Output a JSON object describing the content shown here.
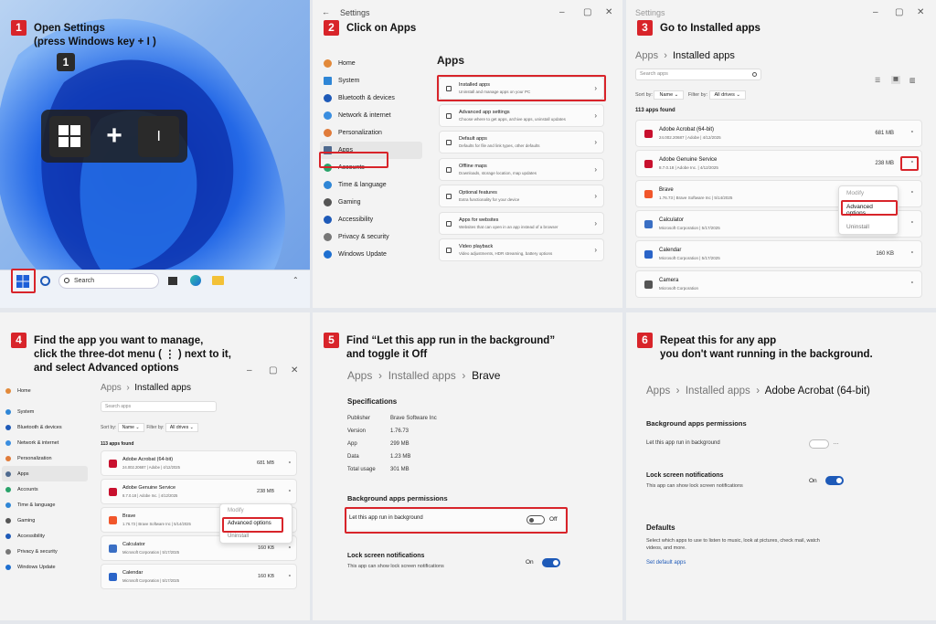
{
  "colors": {
    "accent": "#d8242a",
    "toggle_on": "#1e5ab8",
    "win_blue": "#1d5fd8"
  },
  "p1": {
    "num": "1",
    "title1": "Open Settings",
    "title2": "(press Windows key + I )",
    "badge": "1",
    "key_plus": "+",
    "key_i": "I",
    "search": "Search"
  },
  "p2": {
    "num": "2",
    "title": "Click on Apps",
    "win_title": "Settings",
    "header": "Apps",
    "nav": [
      "Home",
      "System",
      "Bluetooth & devices",
      "Network & internet",
      "Personalization",
      "Apps",
      "Accounts",
      "Time & language",
      "Gaming",
      "Accessibility",
      "Privacy & security",
      "Windows Update"
    ],
    "items": [
      {
        "t": "Installed apps",
        "d": "Uninstall and manage apps on your PC"
      },
      {
        "t": "Advanced app settings",
        "d": "Choose where to get apps, archive apps, uninstall updates"
      },
      {
        "t": "Default apps",
        "d": "Defaults for file and link types, other defaults"
      },
      {
        "t": "Offline maps",
        "d": "Downloads, storage location, map updates"
      },
      {
        "t": "Optional features",
        "d": "Extra functionality for your device"
      },
      {
        "t": "Apps for websites",
        "d": "Websites that can open in an app instead of a browser"
      },
      {
        "t": "Video playback",
        "d": "Video adjustments, HDR streaming, battery options"
      }
    ]
  },
  "p3": {
    "num": "3",
    "title": "Go to Installed apps",
    "win_title": "Settings",
    "crumb1": "Apps",
    "crumb2": "Installed apps",
    "search": "Search apps",
    "sortby": "Sort by:",
    "sortval": "Name",
    "filter": "Filter by:",
    "filterval": "All drives",
    "count": "113 apps found",
    "apps": [
      {
        "n": "Adobe Acrobat (64-bit)",
        "m": "24.002.20687  |  Adobe  |  4/12/2025",
        "s": "681 MB",
        "c": "#c8102e"
      },
      {
        "n": "Adobe Genuine Service",
        "m": "8.7.0.18  |  Adobe Inc.  |  4/12/2025",
        "s": "238 MB",
        "c": "#c8102e"
      },
      {
        "n": "Brave",
        "m": "1.76.73  |  Brave Software Inc  |  5/14/2025",
        "s": "",
        "c": "#f1562b"
      },
      {
        "n": "Calculator",
        "m": "Microsoft Corporation  |  5/17/2025",
        "s": "",
        "c": "#3a6fc4"
      },
      {
        "n": "Calendar",
        "m": "Microsoft Corporation  |  5/17/2025",
        "s": "160 KB",
        "c": "#2a64c8"
      },
      {
        "n": "Camera",
        "m": "Microsoft Corporation",
        "s": "",
        "c": "#555"
      }
    ],
    "menu": [
      "Modify",
      "Advanced options",
      "Uninstall"
    ]
  },
  "p4": {
    "num": "4",
    "title1": "Find the app you want to manage,",
    "title2": "click the three-dot menu ( ⋮ ) next to it,",
    "title3": "and select Advanced options",
    "crumb1": "Apps",
    "crumb2": "Installed apps",
    "search": "Search apps",
    "sortby": "Sort by:",
    "sortval": "Name",
    "filter": "Filter by:",
    "filterval": "All drives",
    "count": "113 apps found",
    "nav": [
      "Home",
      "System",
      "Bluetooth & devices",
      "Network & internet",
      "Personalization",
      "Apps",
      "Accounts",
      "Time & language",
      "Gaming",
      "Accessibility",
      "Privacy & security",
      "Windows Update"
    ],
    "apps": [
      {
        "n": "Adobe Acrobat (64-bit)",
        "m": "24.002.20687  |  Adobe  |  4/12/2025",
        "s": "681 MB",
        "c": "#c8102e"
      },
      {
        "n": "Adobe Genuine Service",
        "m": "8.7.0.18  |  Adobe Inc.  |  4/12/2025",
        "s": "238 MB",
        "c": "#c8102e"
      },
      {
        "n": "Brave",
        "m": "1.76.73  |  Brave Software Inc  |  5/14/2025",
        "s": "",
        "c": "#f1562b"
      },
      {
        "n": "Calculator",
        "m": "Microsoft Corporation  |  5/17/2025",
        "s": "160 KB",
        "c": "#3a6fc4"
      },
      {
        "n": "Calendar",
        "m": "Microsoft Corporation  |  5/17/2025",
        "s": "160 KB",
        "c": "#2a64c8"
      }
    ],
    "menu": [
      "Modify",
      "Advanced options",
      "Uninstall"
    ]
  },
  "p5": {
    "num": "5",
    "title1": "Find “Let this app run in the background”",
    "title2": "and toggle it Off",
    "crumb1": "Apps",
    "crumb2": "Installed apps",
    "crumb3": "Brave",
    "spec_h": "Specifications",
    "specs": [
      {
        "k": "Publisher",
        "v": "Brave Software Inc"
      },
      {
        "k": "Version",
        "v": "1.76.73"
      },
      {
        "k": "App",
        "v": "299 MB"
      },
      {
        "k": "Data",
        "v": "1.23 MB"
      },
      {
        "k": "Total usage",
        "v": "301 MB"
      }
    ],
    "bg_h": "Background apps permissions",
    "bg_label": "Let this app run in background",
    "bg_state": "Off",
    "lock_h": "Lock screen notifications",
    "lock_d": "This app can show lock screen notifications",
    "lock_state": "On"
  },
  "p6": {
    "num": "6",
    "title1": "Repeat this for any app",
    "title2": "you don't want running in the background.",
    "crumb1": "Apps",
    "crumb2": "Installed apps",
    "crumb3": "Adobe Acrobat (64-bit)",
    "bg_h": "Background apps permissions",
    "bg_label": "Let this app run in background",
    "lock_h": "Lock screen notifications",
    "lock_d": "This app can show lock screen notifications",
    "lock_state": "On",
    "def_h": "Defaults",
    "def_d": "Select which apps to use to listen to music, look at pictures, check mail, watch videos, and more.",
    "def_link": "Set default apps"
  }
}
